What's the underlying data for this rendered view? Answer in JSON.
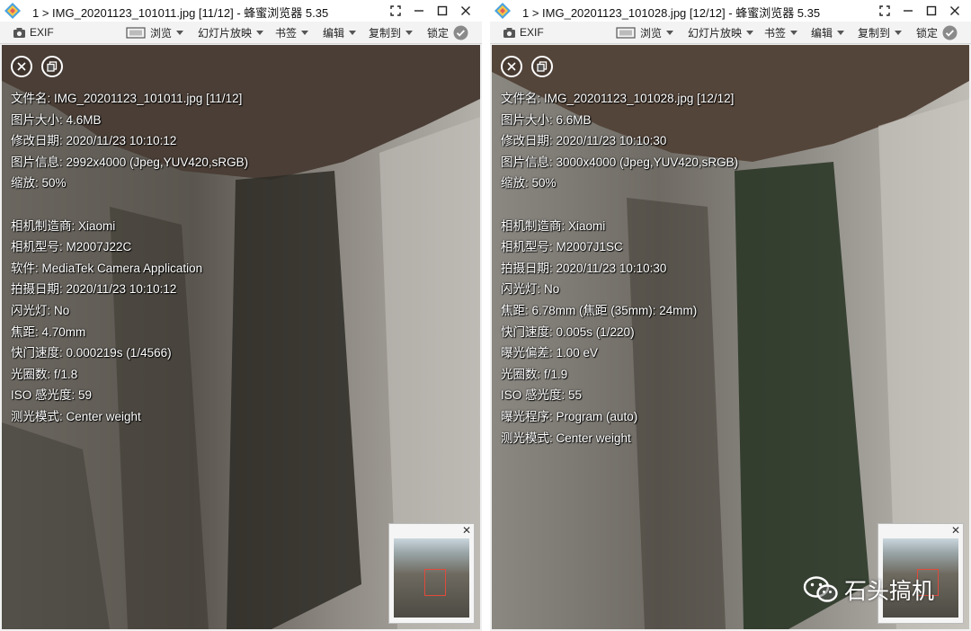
{
  "left": {
    "title": "1 > IMG_20201123_101011.jpg [11/12] - 蜂蜜浏览器 5.35",
    "toolbar": {
      "exif": "EXIF",
      "browse": "浏览",
      "slideshow": "幻灯片放映",
      "bookmark": "书签",
      "edit": "编辑",
      "copy_to": "复制到",
      "lock": "锁定"
    },
    "info": [
      "文件名: IMG_20201123_101011.jpg [11/12]",
      "图片大小: 4.6MB",
      "修改日期: 2020/11/23 10:10:12",
      "图片信息: 2992x4000 (Jpeg,YUV420,sRGB)",
      "缩放: 50%",
      "",
      "相机制造商: Xiaomi",
      "相机型号: M2007J22C",
      "软件: MediaTek Camera Application",
      "拍摄日期: 2020/11/23 10:10:12",
      "闪光灯: No",
      "焦距: 4.70mm",
      "快门速度: 0.000219s (1/4566)",
      "光圈数: f/1.8",
      "ISO 感光度: 59",
      "测光模式: Center weight"
    ]
  },
  "right": {
    "title": "1 > IMG_20201123_101028.jpg [12/12] - 蜂蜜浏览器 5.35",
    "toolbar": {
      "exif": "EXIF",
      "browse": "浏览",
      "slideshow": "幻灯片放映",
      "bookmark": "书签",
      "edit": "编辑",
      "copy_to": "复制到",
      "lock": "锁定"
    },
    "info": [
      "文件名: IMG_20201123_101028.jpg [12/12]",
      "图片大小: 6.6MB",
      "修改日期: 2020/11/23 10:10:30",
      "图片信息: 3000x4000 (Jpeg,YUV420,sRGB)",
      "缩放: 50%",
      "",
      "相机制造商: Xiaomi",
      "相机型号: M2007J1SC",
      "拍摄日期: 2020/11/23 10:10:30",
      "闪光灯: No",
      "焦距: 6.78mm (焦距 (35mm): 24mm)",
      "快门速度: 0.005s (1/220)",
      "曝光偏差: 1.00 eV",
      "光圈数: f/1.9",
      "ISO 感光度: 55",
      "曝光程序: Program (auto)",
      "测光模式: Center weight"
    ]
  },
  "icons": {
    "app": "honeyview-icon",
    "camera": "camera-icon",
    "slideshow": "slideshow-icon",
    "lock": "lock-check-icon",
    "close_overlay": "close-icon",
    "copy_overlay": "copy-icon",
    "wechat": "wechat-icon"
  },
  "watermark": {
    "text": "石头搞机"
  },
  "colors": {
    "minimap_box": "#e04a3a",
    "title_bg": "#ffffff",
    "toolbar_bg": "#f3f3f3"
  }
}
